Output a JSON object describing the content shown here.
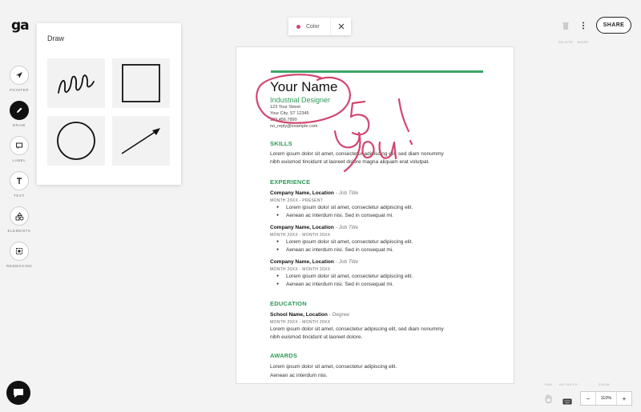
{
  "app": {
    "logo": "ga"
  },
  "left_tools": [
    {
      "label": "POINTER",
      "icon": "pointer-icon"
    },
    {
      "label": "DRAW",
      "icon": "pencil-icon",
      "active": true
    },
    {
      "label": "LABEL",
      "icon": "label-icon"
    },
    {
      "label": "TEXT",
      "icon": "text-icon"
    },
    {
      "label": "ELEMENTS",
      "icon": "shapes-icon"
    },
    {
      "label": "REDBOXING",
      "icon": "redbox-icon"
    }
  ],
  "draw_panel": {
    "title": "Draw",
    "tools": [
      "squiggle-icon",
      "square-icon",
      "circle-icon",
      "arrow-icon"
    ]
  },
  "color_bar": {
    "label": "Color",
    "color": "#d24670"
  },
  "top_right": {
    "delete_label": "DELETE",
    "more_label": "MORE",
    "share_label": "SHARE"
  },
  "resume": {
    "name": "Your Name",
    "job_title": "Industrial Designer",
    "address": "123 Your Street",
    "city": "Your City, ST 12345",
    "phone": "123.456.7890",
    "email": "no_reply@example.com",
    "accent": "#2f9a57",
    "sections": {
      "skills": {
        "heading": "SKILLS",
        "line1": "Lorem ipsum dolor sit amet, consectetur adipiscing elit, sed diam nonummy",
        "line2": "nibh euismod tincidunt ut laoreet dolore magna aliquam erat volutpat."
      },
      "experience": {
        "heading": "EXPERIENCE",
        "jobs": [
          {
            "company": "Company Name,  Location",
            "title": " - Job Title",
            "dates": "MONTH 20XX - PRESENT",
            "b1": "Lorem ipsum dolor sit amet, consectetur adipiscing elit.",
            "b2": "Aenean ac interdum nisi. Sed in consequat mi."
          },
          {
            "company": "Company Name, Location",
            "title": " - Job Title",
            "dates": "MONTH 20XX - MONTH 20XX",
            "b1": "Lorem ipsum dolor sit amet, consectetur adipiscing elit.",
            "b2": "Aenean ac interdum nisi. Sed in consequat mi."
          },
          {
            "company": "Company Name, Location",
            "title": " - Job Title",
            "dates": "MONTH 20XX - MONTH 20XX",
            "b1": "Lorem ipsum dolor sit amet, consectetur adipiscing elit.",
            "b2": "Aenean ac interdum nisi. Sed in consequat mi."
          }
        ]
      },
      "education": {
        "heading": "EDUCATION",
        "school": "School Name, Location",
        "degree": " - Degree",
        "dates": "MONTH 20XX - MONTH 20XX",
        "line1": "Lorem ipsum dolor sit amet, consectetur adipiscing elit, sed diam nonummy",
        "line2": "nibh euismod tincidunt ut laoreet dolore."
      },
      "awards": {
        "heading": "AWARDS",
        "line1": "Lorem ipsum dolor sit amet, consectetur adipiscing elit.",
        "line2": "Aenean ac interdum nisi."
      }
    }
  },
  "annotation": {
    "text": "5 You!",
    "color": "#d24670"
  },
  "bottom": {
    "pan_label": "PAN",
    "hotkeys_label": "HOTKEYS",
    "zoom_label": "ZOOM",
    "zoom_value": "110%",
    "zoom_minus": "−",
    "zoom_plus": "+"
  }
}
